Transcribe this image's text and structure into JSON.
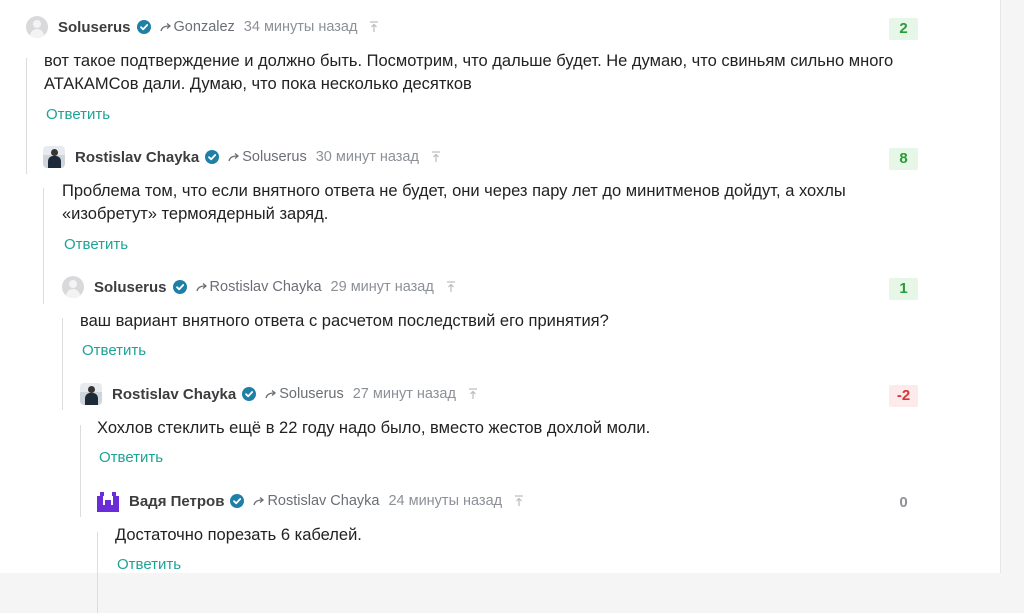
{
  "comments": [
    {
      "author": "Soluserus",
      "reply_to": "Gonzalez",
      "time": "34 минуты назад",
      "score": "2",
      "score_type": "positive",
      "avatar": "default-avatar",
      "text_lines": [
        "вот такое подтверждение и должно быть. Посмотрим, что дальше будет. Не думаю, что свиньям сильно много",
        "АТАКАМСов дали. Думаю, что пока несколько десятков"
      ],
      "reply_label": "Ответить"
    },
    {
      "author": "Rostislav Chayka",
      "reply_to": "Soluserus",
      "time": "30 минут назад",
      "score": "8",
      "score_type": "positive",
      "avatar": "photo-avatar",
      "text_lines": [
        "Проблема том, что если внятного ответа не будет, они через пару лет до минитменов дойдут, а хохлы",
        "«изобретут» термоядерный заряд."
      ],
      "reply_label": "Ответить"
    },
    {
      "author": "Soluserus",
      "reply_to": "Rostislav Chayka",
      "time": "29 минут назад",
      "score": "1",
      "score_type": "positive",
      "avatar": "default-avatar",
      "text_lines": [
        "ваш вариант внятного ответа с расчетом последствий его принятия?"
      ],
      "reply_label": "Ответить"
    },
    {
      "author": "Rostislav Chayka",
      "reply_to": "Soluserus",
      "time": "27 минут назад",
      "score": "-2",
      "score_type": "negative",
      "avatar": "photo-avatar",
      "text_lines": [
        "Хохлов стеклить ещё в 22 году надо было, вместо жестов дохлой моли."
      ],
      "reply_label": "Ответить"
    },
    {
      "author": "Вадя Петров",
      "reply_to": "Rostislav Chayka",
      "time": "24 минуты назад",
      "score": "0",
      "score_type": "neutral",
      "avatar": "pixel-avatar",
      "text_lines": [
        "Достаточно порезать 6 кабелей."
      ],
      "reply_label": "Ответить"
    }
  ],
  "colors": {
    "accent": "#1ea396",
    "verified": "#1f7fa6",
    "positive": "#2b9a38",
    "negative": "#d43535",
    "pixel_avatar": "#6a2cd8"
  },
  "icons": {
    "verified": "verified-check-icon",
    "reply": "reply-arrow-icon",
    "pin": "pin-to-top-icon"
  }
}
